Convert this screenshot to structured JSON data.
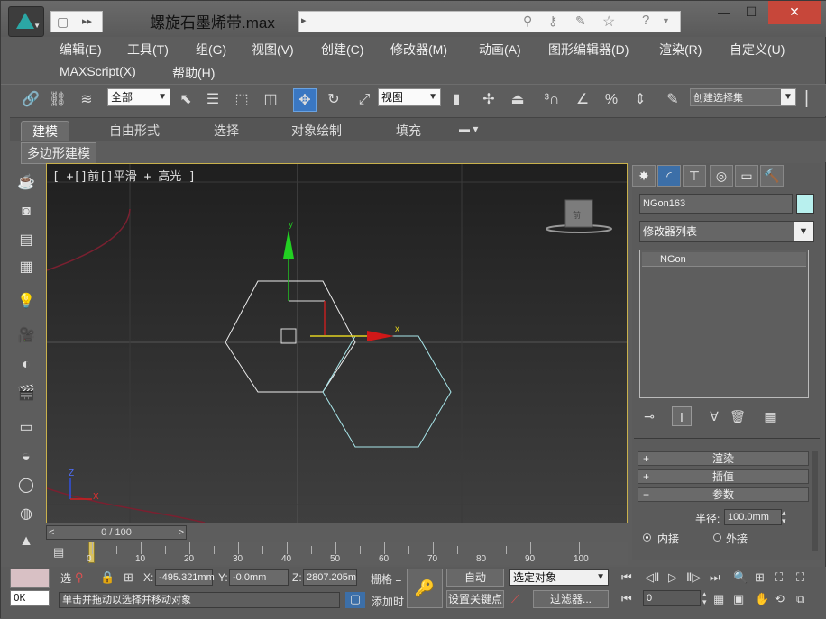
{
  "window": {
    "title": "螺旋石墨烯带.max",
    "controls": {
      "minimize": "—",
      "maximize": "☐",
      "close": "✕"
    }
  },
  "menu": {
    "row1": [
      "编辑(E)",
      "工具(T)",
      "组(G)",
      "视图(V)",
      "创建(C)",
      "修改器(M)",
      "动画(A)",
      "图形编辑器(D)",
      "渲染(R)",
      "自定义(U)"
    ],
    "row2": [
      "MAXScript(X)",
      "帮助(H)"
    ]
  },
  "toolbar": {
    "selection_filter": "全部",
    "ref_coord": "视图",
    "named_selection": "创建选择集"
  },
  "ribbon": {
    "tabs": [
      "建模",
      "自由形式",
      "选择",
      "对象绘制",
      "填充"
    ],
    "active_tab": "建模",
    "subtab": "多边形建模"
  },
  "viewport": {
    "label": "[ +[]前[]平滑 + 高光 ]",
    "gizmo_x": "x",
    "gizmo_y": "y",
    "axis_z": "Z",
    "axis_x": "X",
    "viewcube_face": "前"
  },
  "command_panel": {
    "object_name": "NGon163",
    "object_color": "#b8f0ee",
    "modifier_list": "修改器列表",
    "stack_items": [
      "NGon"
    ],
    "rollouts": [
      {
        "sign": "+",
        "label": "渲染"
      },
      {
        "sign": "+",
        "label": "插值"
      },
      {
        "sign": "−",
        "label": "参数"
      }
    ],
    "radius_label": "半径:",
    "radius_value": "100.0mm",
    "radio_inscribed": "内接",
    "radio_circumscribed": "外接",
    "radio_selected": "内接"
  },
  "timeline": {
    "frame_display": "0 / 100",
    "prev": "<",
    "next": ">",
    "ticks": [
      "0",
      "10",
      "20",
      "30",
      "40",
      "50",
      "60",
      "70",
      "80",
      "90",
      "100"
    ]
  },
  "status": {
    "script_output": "OK",
    "prompt": "单击并拖动以选择并移动对象",
    "x_label": "X:",
    "x_value": "-495.321mm",
    "y_label": "Y:",
    "y_value": "-0.0mm",
    "z_label": "Z:",
    "z_value": "2807.205m",
    "grid_label": "栅格 =",
    "add_time_tag": "添加时",
    "auto_key": "自动",
    "set_key": "设置关键点",
    "key_filter_select": "选定对象",
    "filters": "过滤器...",
    "frame_value": "0",
    "small_label": "选"
  }
}
